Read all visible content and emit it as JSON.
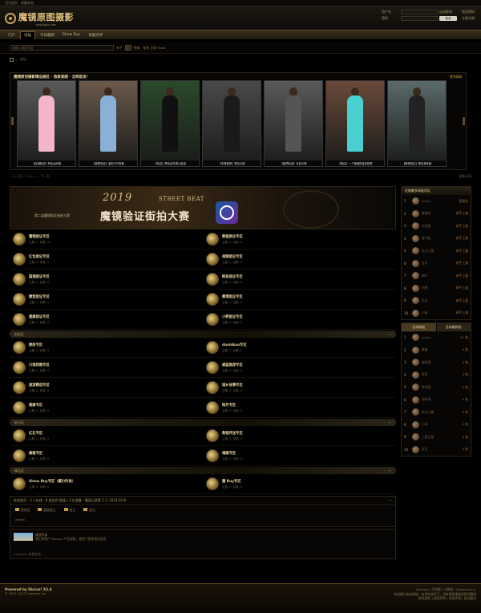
{
  "topbar": {
    "items": [
      "设为首页",
      "收藏本站"
    ]
  },
  "header": {
    "logo_title": "魔镜原图摄影",
    "logo_sub": "mojingpic.com",
    "login": {
      "user_label": "用户名",
      "pass_label": "密码",
      "remember": "自动登录",
      "login_btn": "登录",
      "register": "立即注册",
      "forgot": "找回密码"
    }
  },
  "nav": [
    {
      "label": "门户"
    },
    {
      "label": "论坛"
    },
    {
      "label": "今日最新"
    },
    {
      "label": "Show Buy"
    },
    {
      "label": "日服点评"
    }
  ],
  "search": {
    "placeholder": "请输入搜索内容",
    "type": "帖子",
    "hot_label": "热搜:",
    "hot_items": "街拍  正妹  Show"
  },
  "breadcrumb": {
    "label": "论坛"
  },
  "gallery": {
    "title": "魔镜原创摄影精品展区 · 独家美图 · 全网首发！",
    "more": "更多精彩",
    "photos": [
      {
        "caption": "【店铺验证】粉色运动裤"
      },
      {
        "caption": "【魔镜验证】蓝色牛仔短裤"
      },
      {
        "caption": "【验证】黑色连衣裙小姐姐"
      },
      {
        "caption": "【本周推荐】黑色长裙"
      },
      {
        "caption": "【魔镜验证】灰色长裤"
      },
      {
        "caption": "【验证】一个路遇的蓝色短裙"
      },
      {
        "caption": "【魔镜验证】黑色紧身裤"
      }
    ]
  },
  "pager": {
    "left": "‹ 上一页   1 2 3 4 5 ...   下一页 ›",
    "right": "更新记录"
  },
  "banner": {
    "year": "2019",
    "en": "STREET BEAT",
    "title": "魔镜验证街拍大赛",
    "sub": "第二届魔镜验证街拍大赛"
  },
  "sections": [
    {
      "title": "",
      "forums": [
        {
          "name": "魔镜验证专区",
          "meta": "主题: 2, 帖数: 21"
        },
        {
          "name": "教程验证专区",
          "meta": "主题: 0, 帖数: 0"
        },
        {
          "name": "红包验证专区",
          "meta": "主题: 0, 帖数: 0"
        },
        {
          "name": "视频验证专区",
          "meta": "主题: 0, 帖数: 0"
        },
        {
          "name": "国潮验证专区",
          "meta": "主题: 0, 帖数: 0"
        },
        {
          "name": "韩系验证专区",
          "meta": "主题: 0, 帖数: 0"
        },
        {
          "name": "摩登验证专区",
          "meta": "主题: 0, 帖数: 0"
        },
        {
          "name": "赛博验证专区",
          "meta": "主题: 0, 帖数: 0"
        },
        {
          "name": "健康验证专区",
          "meta": "主题: 0, 帖数: 0"
        },
        {
          "name": "小野验证专区",
          "meta": "主题: 0, 帖数: 0"
        }
      ]
    },
    {
      "title": "街拍区",
      "forums": [
        {
          "name": "厨房专区",
          "meta": "主题: 0, 帖数: 0"
        },
        {
          "name": "davidkao专区",
          "meta": "主题: 0, 帖数: 0"
        },
        {
          "name": "只推荐图专区",
          "meta": "主题: 0, 帖数: 0"
        },
        {
          "name": "威猛推荐专区",
          "meta": "主题: 0, 帖数: 0"
        },
        {
          "name": "速游精选专区",
          "meta": "主题: 0, 帖数: 0"
        },
        {
          "name": "城乡故事专区",
          "meta": "主题: 0, 帖数: 0"
        },
        {
          "name": "健康专区",
          "meta": "主题: 0, 帖数: 0"
        },
        {
          "name": "除月专区",
          "meta": "主题: 0, 帖数: 0"
        }
      ]
    },
    {
      "title": "新分区",
      "forums": [
        {
          "name": "红石专区",
          "meta": "主题: 0, 帖数: 0"
        },
        {
          "name": "教程传送专区",
          "meta": "主题: 0, 帖数: 0"
        },
        {
          "name": "蜂蜡专区",
          "meta": "主题: 0, 帖数: 0"
        },
        {
          "name": "魂魄专区",
          "meta": "主题: 0, 帖数: 0"
        }
      ]
    },
    {
      "title": "精品区",
      "forums": [
        {
          "name": "Show Buy专区（藏力时尚）",
          "meta": "主题: 0, 帖数: 0"
        },
        {
          "name": "魔 Buy专区",
          "meta": "主题: 0, 帖数: 0"
        }
      ]
    }
  ],
  "stats": {
    "head": "在线会员 - 3 人在线 - 0 会员(0 隐身), 3 位游客 - 最高记录是 2 于 2019-10-8.",
    "legend": [
      "管理员",
      "超级版主",
      "版主",
      "会员"
    ],
    "online": "admin"
  },
  "links": {
    "ad_text": "魔镜传媒\n我们的客户 Discuz! 产品授权，使用了更多相关信息",
    "friend": "Comsenz    其他友站"
  },
  "side": {
    "panel_title": "近期最多高贴验证",
    "ranks1": [
      {
        "n": "1",
        "nm": "admin",
        "v": "管理员"
      },
      {
        "n": "2",
        "nm": "蜂蜡哥",
        "v": "新手上路"
      },
      {
        "n": "3",
        "nm": "半街图",
        "v": "新手上路"
      },
      {
        "n": "4",
        "nm": "爱书友",
        "v": "新手上路"
      },
      {
        "n": "5",
        "nm": "东方之翼",
        "v": "新手上路"
      },
      {
        "n": "6",
        "nm": "金月",
        "v": "新手上路"
      },
      {
        "n": "7",
        "nm": "骑行",
        "v": "新手上路"
      },
      {
        "n": "8",
        "nm": "阿星",
        "v": "新手上路"
      },
      {
        "n": "9",
        "nm": "凯风",
        "v": "新手上路"
      },
      {
        "n": "10",
        "nm": "小新",
        "v": "新手上路"
      }
    ],
    "tabs": [
      "总体热帖",
      "总体最新帖"
    ],
    "ranks2": [
      {
        "n": "1",
        "nm": "admin",
        "v": "21 帖"
      },
      {
        "n": "2",
        "nm": "蜂蜡",
        "v": "0 帖"
      },
      {
        "n": "3",
        "nm": "秦岗哥",
        "v": "0 帖"
      },
      {
        "n": "4",
        "nm": "蔡家",
        "v": "0 帖"
      },
      {
        "n": "5",
        "nm": "梦境图",
        "v": "0 帖"
      },
      {
        "n": "6",
        "nm": "周明泽",
        "v": "0 帖"
      },
      {
        "n": "7",
        "nm": "东方之翼",
        "v": "0 帖"
      },
      {
        "n": "8",
        "nm": "小新",
        "v": "0 帖"
      },
      {
        "n": "9",
        "nm": "三星之星",
        "v": "0 帖"
      },
      {
        "n": "10",
        "nm": "红石",
        "v": "0 帖"
      }
    ]
  },
  "footer": {
    "powered": "Powered by Discuz! X3.4",
    "copy": "© 2001-2017 Comsenz Inc.",
    "right1": "Archiver | 手机版 | 小黑屋 | Comsenz Inc.",
    "right2": "本站图片来自网络，仅供交流学习，如有侵权请联系我们删除",
    "right3": "联系我们 | 版权声明 | 免责声明 | 投诉建议"
  }
}
